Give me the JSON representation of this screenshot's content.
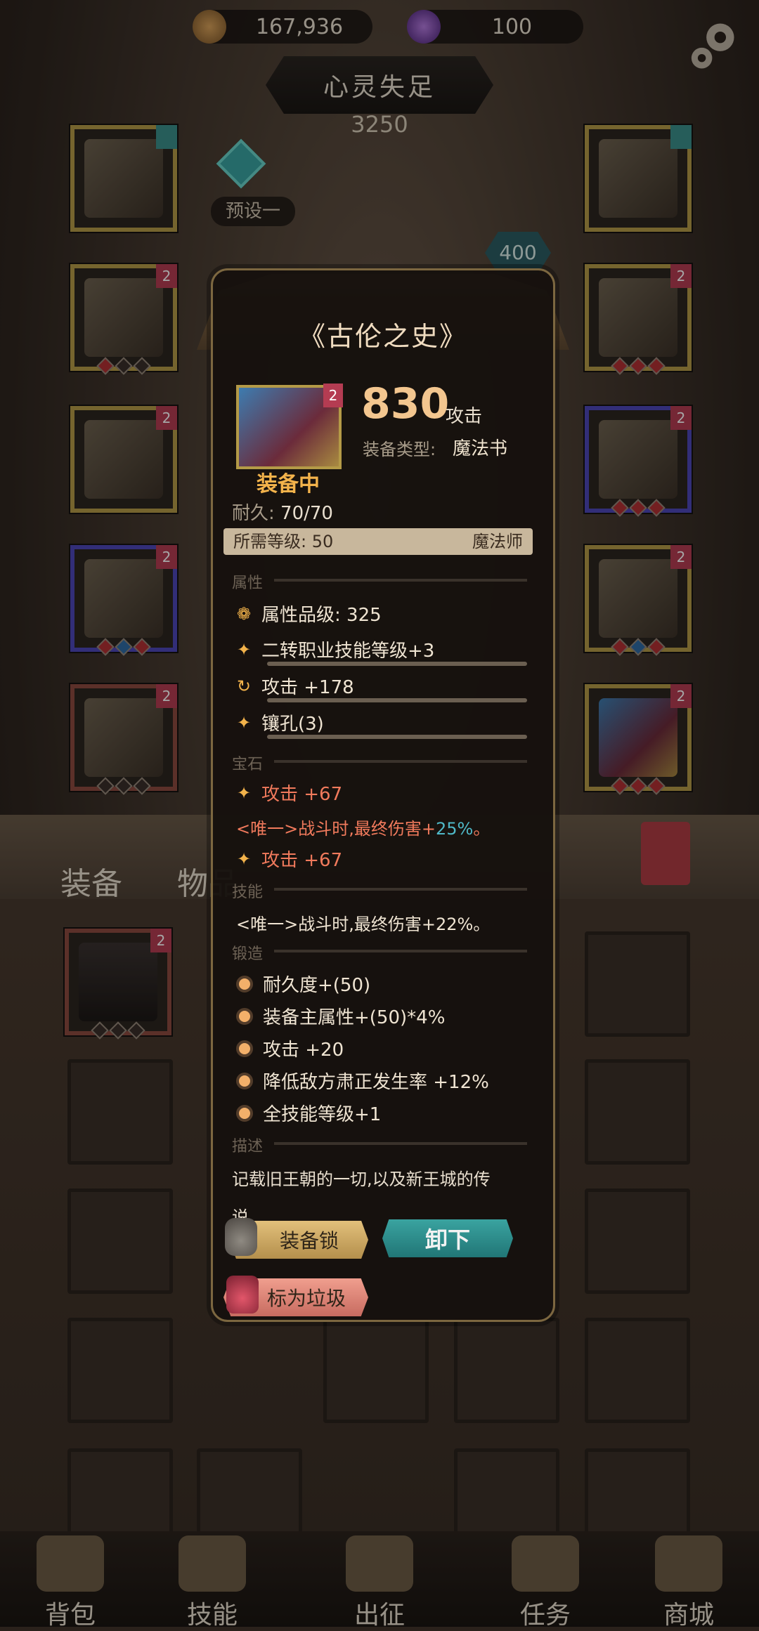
{
  "currency": {
    "gold": "167,936",
    "gems": "100"
  },
  "header": {
    "title": "心灵失足",
    "power": "3250",
    "preset": "预设一",
    "badge": "400"
  },
  "popup": {
    "title": "《古伦之史》",
    "attack_value": "830",
    "attack_unit": "攻击",
    "equip_type_label": "装备类型:",
    "equip_type_value": "魔法书",
    "equipped_label": "装备中",
    "durability_label": "耐久:",
    "durability_value": "70/70",
    "required_level": "所需等级: 50",
    "required_class": "魔法师",
    "item_tag": "2",
    "sections": {
      "attributes": "属性",
      "gems": "宝石",
      "skills": "技能",
      "forge": "锻造",
      "description": "描述"
    },
    "attributes": {
      "grade": "属性品级: 325",
      "line1": "二转职业技能等级+3",
      "line2": "攻击 +178",
      "line3": "镶孔(3)"
    },
    "gems": {
      "gem1": "攻击 +67",
      "gem1_effect_prefix": "<唯一>战斗时,最终伤害+",
      "gem1_effect_value": "25%",
      "gem1_effect_suffix": "。",
      "gem2": "攻击 +67"
    },
    "skill_line": "<唯一>战斗时,最终伤害+22%。",
    "forge": [
      "耐久度+(50)",
      "装备主属性+(50)*4%",
      "攻击 +20",
      "降低敌方肃正发生率 +12%",
      "全技能等级+1"
    ],
    "description_line1": "记载旧王朝的一切,以及新王城的传",
    "description_line2": "说",
    "buttons": {
      "lock": "装备锁",
      "unequip": "卸下",
      "junk": "标为垃圾"
    }
  },
  "tabs": {
    "equipment": "装备",
    "items": "物品"
  },
  "nav": [
    {
      "label": "背包",
      "icon": "backpack-icon"
    },
    {
      "label": "技能",
      "icon": "skill-book-icon"
    },
    {
      "label": "出征",
      "icon": "sword-map-icon"
    },
    {
      "label": "任务",
      "icon": "horn-icon"
    },
    {
      "label": "商城",
      "icon": "shop-crown-icon"
    }
  ],
  "colors": {
    "accent": "#f3b34b",
    "teal": "#3aa3a0",
    "danger": "#f17a5c"
  }
}
